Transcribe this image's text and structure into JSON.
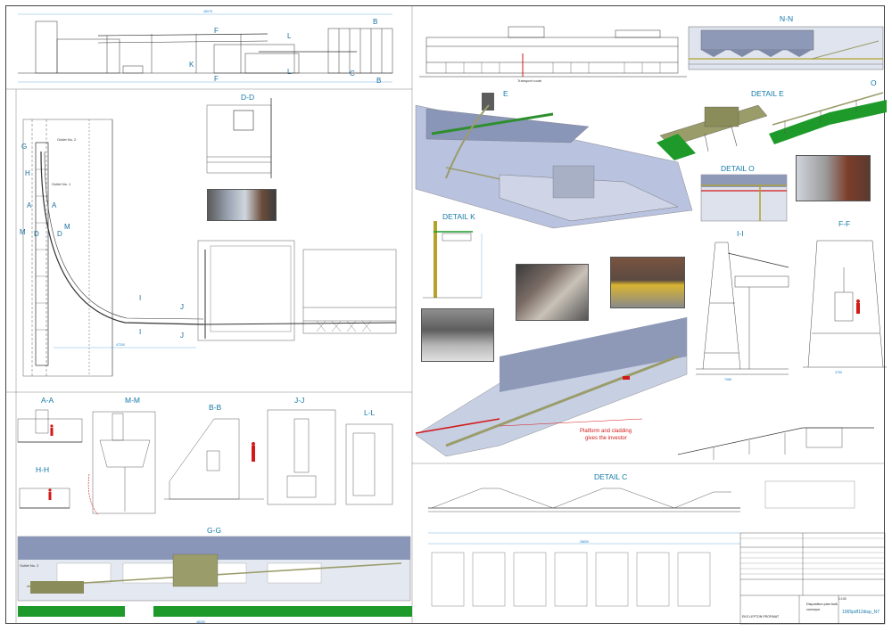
{
  "views": {
    "nn": "N-N",
    "detail_e_photo": "E",
    "detail_e": "DETAIL E",
    "o": "O",
    "detail_o": "DETAIL O",
    "detail_k": "DETAIL K",
    "dd": "D-D",
    "ii": "I-I",
    "ff": "F-F",
    "aa": "A-A",
    "mm": "M-M",
    "bb": "B-B",
    "jj": "J-J",
    "ll": "L-L",
    "hh": "H-H",
    "gg": "G-G",
    "detail_c": "DETAIL C"
  },
  "section_marks": {
    "f_top": "F",
    "f_bottom": "F",
    "k": "K",
    "l_top": "L",
    "l_bottom": "L",
    "b_top": "B",
    "b_bottom": "B",
    "c": "C",
    "g": "G",
    "h": "H",
    "a_left": "A",
    "a_right": "A",
    "m_left": "M",
    "m_right": "M",
    "d_left": "D",
    "d_right": "D",
    "i_top": "I",
    "i_bottom": "I",
    "j_top": "J",
    "j_bottom": "J"
  },
  "annotations": {
    "platform_line1": "Platform and cladding",
    "platform_line2": "gives the investor",
    "outlet_no2": "Outlet No. 2",
    "outlet_no1": "Outlet No. 1",
    "outlet_no2_gg": "Outlet No. 2",
    "transport_route": "Transport route"
  },
  "dimensions": {
    "top_total": "45075",
    "detail_c_total": "28830",
    "gg_total": "48200",
    "plan_run": "47200",
    "i_span": "7085",
    "ff_span": "3750"
  },
  "title_block": {
    "drawing_no": "1065pdf12disp_N7",
    "description_line1": "Disposition plan bulk",
    "description_line2": "conveyor",
    "scale": "1:100",
    "company": "EKO LEPTON PROFIMAT"
  },
  "colors": {
    "line": "#2f2f2f",
    "label": "#147aa8",
    "dimension": "#1a7fd0",
    "accent_red": "#d21919",
    "ground_green": "#1e9a2b",
    "model_blue": "#8a9bc8",
    "model_steel": "#9a9c6a",
    "silo_blue": "#8e99b8"
  }
}
